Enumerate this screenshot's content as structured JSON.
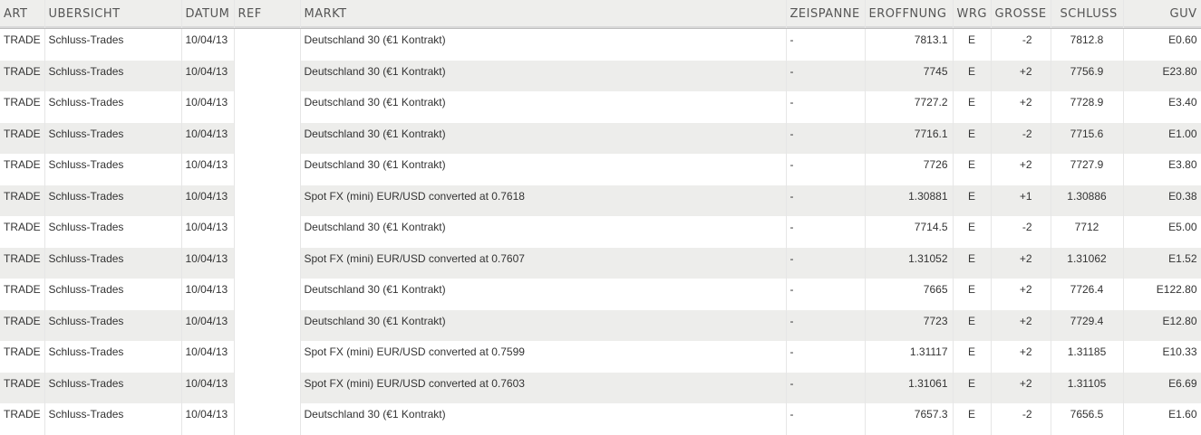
{
  "headers": {
    "art": "ART",
    "uebersicht": "ÜBERSICHT",
    "datum": "DATUM",
    "ref": "REF",
    "markt": "MARKT",
    "zeitspanne": "ZEISPANNE",
    "eroeffnung": "ERÖFFNUNG",
    "wrg": "WRG",
    "groesse": "GRÖSSE",
    "schluss": "SCHLUSS",
    "guv": "GUV"
  },
  "rows": [
    {
      "art": "TRADE",
      "uebersicht": "Schluss-Trades",
      "datum": "10/04/13",
      "ref": "",
      "markt": "Deutschland 30 (€1 Kontrakt)",
      "zeitspanne": "-",
      "eroeffnung": "7813.1",
      "wrg": "E",
      "groesse": "-2",
      "schluss": "7812.8",
      "guv": "E0.60"
    },
    {
      "art": "TRADE",
      "uebersicht": "Schluss-Trades",
      "datum": "10/04/13",
      "ref": "",
      "markt": "Deutschland 30 (€1 Kontrakt)",
      "zeitspanne": "-",
      "eroeffnung": "7745",
      "wrg": "E",
      "groesse": "+2",
      "schluss": "7756.9",
      "guv": "E23.80"
    },
    {
      "art": "TRADE",
      "uebersicht": "Schluss-Trades",
      "datum": "10/04/13",
      "ref": "",
      "markt": "Deutschland 30 (€1 Kontrakt)",
      "zeitspanne": "-",
      "eroeffnung": "7727.2",
      "wrg": "E",
      "groesse": "+2",
      "schluss": "7728.9",
      "guv": "E3.40"
    },
    {
      "art": "TRADE",
      "uebersicht": "Schluss-Trades",
      "datum": "10/04/13",
      "ref": "",
      "markt": "Deutschland 30 (€1 Kontrakt)",
      "zeitspanne": "-",
      "eroeffnung": "7716.1",
      "wrg": "E",
      "groesse": "-2",
      "schluss": "7715.6",
      "guv": "E1.00"
    },
    {
      "art": "TRADE",
      "uebersicht": "Schluss-Trades",
      "datum": "10/04/13",
      "ref": "",
      "markt": "Deutschland 30 (€1 Kontrakt)",
      "zeitspanne": "-",
      "eroeffnung": "7726",
      "wrg": "E",
      "groesse": "+2",
      "schluss": "7727.9",
      "guv": "E3.80"
    },
    {
      "art": "TRADE",
      "uebersicht": "Schluss-Trades",
      "datum": "10/04/13",
      "ref": "",
      "markt": "Spot FX (mini) EUR/USD converted at 0.7618",
      "zeitspanne": "-",
      "eroeffnung": "1.30881",
      "wrg": "E",
      "groesse": "+1",
      "schluss": "1.30886",
      "guv": "E0.38"
    },
    {
      "art": "TRADE",
      "uebersicht": "Schluss-Trades",
      "datum": "10/04/13",
      "ref": "",
      "markt": "Deutschland 30 (€1 Kontrakt)",
      "zeitspanne": "-",
      "eroeffnung": "7714.5",
      "wrg": "E",
      "groesse": "-2",
      "schluss": "7712",
      "guv": "E5.00"
    },
    {
      "art": "TRADE",
      "uebersicht": "Schluss-Trades",
      "datum": "10/04/13",
      "ref": "",
      "markt": "Spot FX (mini) EUR/USD converted at 0.7607",
      "zeitspanne": "-",
      "eroeffnung": "1.31052",
      "wrg": "E",
      "groesse": "+2",
      "schluss": "1.31062",
      "guv": "E1.52"
    },
    {
      "art": "TRADE",
      "uebersicht": "Schluss-Trades",
      "datum": "10/04/13",
      "ref": "",
      "markt": "Deutschland 30 (€1 Kontrakt)",
      "zeitspanne": "-",
      "eroeffnung": "7665",
      "wrg": "E",
      "groesse": "+2",
      "schluss": "7726.4",
      "guv": "E122.80"
    },
    {
      "art": "TRADE",
      "uebersicht": "Schluss-Trades",
      "datum": "10/04/13",
      "ref": "",
      "markt": "Deutschland 30 (€1 Kontrakt)",
      "zeitspanne": "-",
      "eroeffnung": "7723",
      "wrg": "E",
      "groesse": "+2",
      "schluss": "7729.4",
      "guv": "E12.80"
    },
    {
      "art": "TRADE",
      "uebersicht": "Schluss-Trades",
      "datum": "10/04/13",
      "ref": "",
      "markt": "Spot FX (mini) EUR/USD converted at 0.7599",
      "zeitspanne": "-",
      "eroeffnung": "1.31117",
      "wrg": "E",
      "groesse": "+2",
      "schluss": "1.31185",
      "guv": "E10.33"
    },
    {
      "art": "TRADE",
      "uebersicht": "Schluss-Trades",
      "datum": "10/04/13",
      "ref": "",
      "markt": "Spot FX (mini) EUR/USD converted at 0.7603",
      "zeitspanne": "-",
      "eroeffnung": "1.31061",
      "wrg": "E",
      "groesse": "+2",
      "schluss": "1.31105",
      "guv": "E6.69"
    },
    {
      "art": "TRADE",
      "uebersicht": "Schluss-Trades",
      "datum": "10/04/13",
      "ref": "",
      "markt": "Deutschland 30 (€1 Kontrakt)",
      "zeitspanne": "-",
      "eroeffnung": "7657.3",
      "wrg": "E",
      "groesse": "-2",
      "schluss": "7656.5",
      "guv": "E1.60"
    }
  ]
}
